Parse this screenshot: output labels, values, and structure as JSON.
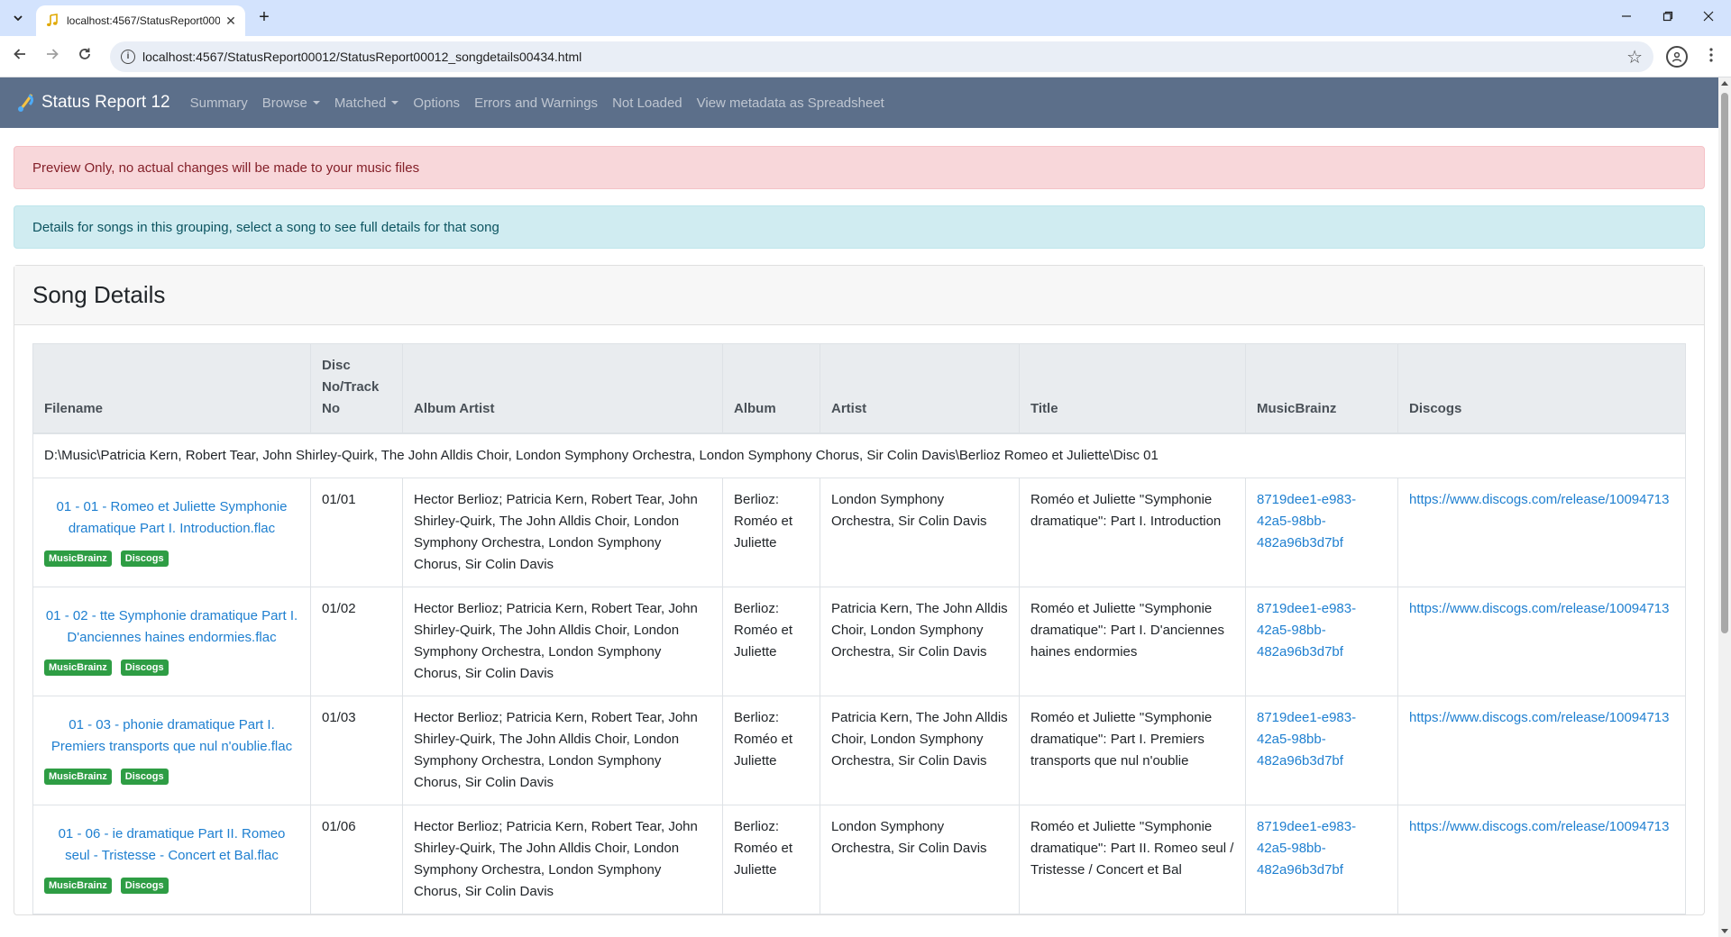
{
  "browser": {
    "tab_title": "localhost:4567/StatusReport000",
    "url": "localhost:4567/StatusReport00012/StatusReport00012_songdetails00434.html",
    "new_tab": "+",
    "close": "✕"
  },
  "navbar": {
    "brand": "Status Report 12",
    "items": [
      "Summary",
      "Browse",
      "Matched",
      "Options",
      "Errors and Warnings",
      "Not Loaded",
      "View metadata as Spreadsheet"
    ]
  },
  "alerts": {
    "preview": "Preview Only, no actual changes will be made to your music files",
    "info": "Details for songs in this grouping, select a song to see full details for that song"
  },
  "card": {
    "title": "Song Details",
    "headers": {
      "filename": "Filename",
      "disc1": "Disc",
      "disc2": "No/Track",
      "disc3": "No",
      "album_artist": "Album Artist",
      "album": "Album",
      "artist": "Artist",
      "title": "Title",
      "musicbrainz": "MusicBrainz",
      "discogs": "Discogs"
    },
    "group_path": "D:\\Music\\Patricia Kern, Robert Tear, John Shirley-Quirk, The John Alldis Choir, London Symphony Orchestra, London Symphony Chorus, Sir Colin Davis\\Berlioz Romeo et Juliette\\Disc 01",
    "badge_mb": "MusicBrainz",
    "badge_discogs": "Discogs",
    "rows": [
      {
        "filename": "01 - 01 - Romeo et Juliette Symphonie dramatique Part I. Introduction.flac",
        "track": "01/01",
        "album_artist": "Hector Berlioz; Patricia Kern, Robert Tear, John Shirley-Quirk, The John Alldis Choir, London Symphony Orchestra, London Symphony Chorus, Sir Colin Davis",
        "album": "Berlioz: Roméo et Juliette",
        "artist": "London Symphony Orchestra, Sir Colin Davis",
        "title": "Roméo et Juliette \"Symphonie dramatique\": Part I. Introduction",
        "musicbrainz": "8719dee1-e983-42a5-98bb-482a96b3d7bf",
        "discogs": "https://www.discogs.com/release/10094713"
      },
      {
        "filename": "01 - 02 - tte Symphonie dramatique Part I. D'anciennes haines endormies.flac",
        "track": "01/02",
        "album_artist": "Hector Berlioz; Patricia Kern, Robert Tear, John Shirley-Quirk, The John Alldis Choir, London Symphony Orchestra, London Symphony Chorus, Sir Colin Davis",
        "album": "Berlioz: Roméo et Juliette",
        "artist": "Patricia Kern, The John Alldis Choir, London Symphony Orchestra, Sir Colin Davis",
        "title": "Roméo et Juliette \"Symphonie dramatique\": Part I. D'anciennes haines endormies",
        "musicbrainz": "8719dee1-e983-42a5-98bb-482a96b3d7bf",
        "discogs": "https://www.discogs.com/release/10094713"
      },
      {
        "filename": "01 - 03 - phonie dramatique Part I. Premiers transports que nul n'oublie.flac",
        "track": "01/03",
        "album_artist": "Hector Berlioz; Patricia Kern, Robert Tear, John Shirley-Quirk, The John Alldis Choir, London Symphony Orchestra, London Symphony Chorus, Sir Colin Davis",
        "album": "Berlioz: Roméo et Juliette",
        "artist": "Patricia Kern, The John Alldis Choir, London Symphony Orchestra, Sir Colin Davis",
        "title": "Roméo et Juliette \"Symphonie dramatique\": Part I. Premiers transports que nul n'oublie",
        "musicbrainz": "8719dee1-e983-42a5-98bb-482a96b3d7bf",
        "discogs": "https://www.discogs.com/release/10094713"
      },
      {
        "filename": "01 - 06 - ie dramatique Part II. Romeo seul - Tristesse - Concert et Bal.flac",
        "track": "01/06",
        "album_artist": "Hector Berlioz; Patricia Kern, Robert Tear, John Shirley-Quirk, The John Alldis Choir, London Symphony Orchestra, London Symphony Chorus, Sir Colin Davis",
        "album": "Berlioz: Roméo et Juliette",
        "artist": "London Symphony Orchestra, Sir Colin Davis",
        "title": "Roméo et Juliette \"Symphonie dramatique\": Part II. Romeo seul / Tristesse / Concert et Bal",
        "musicbrainz": "8719dee1-e983-42a5-98bb-482a96b3d7bf",
        "discogs": "https://www.discogs.com/release/10094713"
      }
    ]
  }
}
